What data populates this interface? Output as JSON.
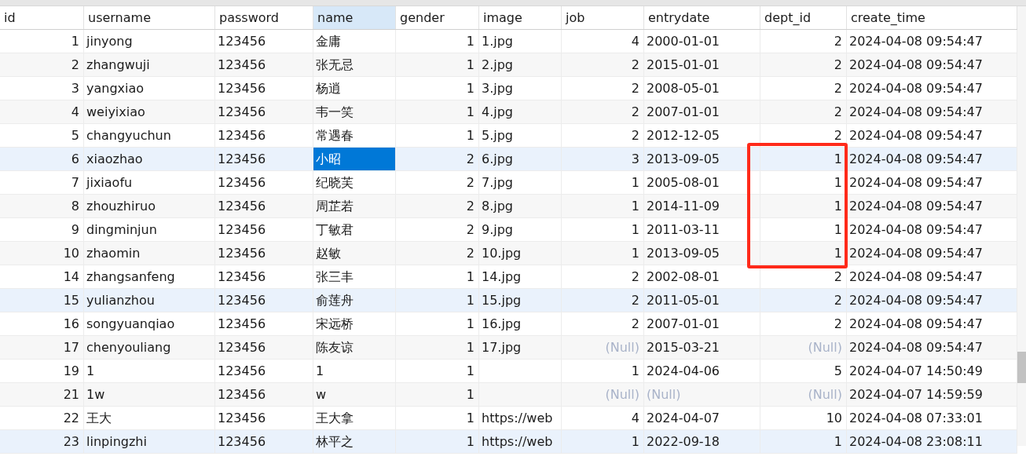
{
  "columns": [
    {
      "label": "id",
      "selected": false
    },
    {
      "label": "username",
      "selected": false
    },
    {
      "label": "password",
      "selected": false
    },
    {
      "label": "name",
      "selected": true
    },
    {
      "label": "gender",
      "selected": false
    },
    {
      "label": "image",
      "selected": false
    },
    {
      "label": "job",
      "selected": false
    },
    {
      "label": "entrydate",
      "selected": false
    },
    {
      "label": "dept_id",
      "selected": false
    },
    {
      "label": "create_time",
      "selected": false
    }
  ],
  "rows": [
    {
      "selected": false,
      "cell_selected": false,
      "boxed": false,
      "cells": [
        "1",
        "jinyong",
        "123456",
        "金庸",
        "1",
        "1.jpg",
        "4",
        "2000-01-01",
        "2",
        "2024-04-08 09:54:47"
      ]
    },
    {
      "selected": false,
      "cell_selected": false,
      "boxed": false,
      "cells": [
        "2",
        "zhangwuji",
        "123456",
        "张无忌",
        "1",
        "2.jpg",
        "2",
        "2015-01-01",
        "2",
        "2024-04-08 09:54:47"
      ]
    },
    {
      "selected": false,
      "cell_selected": false,
      "boxed": false,
      "cells": [
        "3",
        "yangxiao",
        "123456",
        "杨逍",
        "1",
        "3.jpg",
        "2",
        "2008-05-01",
        "2",
        "2024-04-08 09:54:47"
      ]
    },
    {
      "selected": false,
      "cell_selected": false,
      "boxed": false,
      "cells": [
        "4",
        "weiyixiao",
        "123456",
        "韦一笑",
        "1",
        "4.jpg",
        "2",
        "2007-01-01",
        "2",
        "2024-04-08 09:54:47"
      ]
    },
    {
      "selected": false,
      "cell_selected": false,
      "boxed": false,
      "cells": [
        "5",
        "changyuchun",
        "123456",
        "常遇春",
        "1",
        "5.jpg",
        "2",
        "2012-12-05",
        "2",
        "2024-04-08 09:54:47"
      ]
    },
    {
      "selected": true,
      "cell_selected": true,
      "boxed": true,
      "cells": [
        "6",
        "xiaozhao",
        "123456",
        "小昭",
        "2",
        "6.jpg",
        "3",
        "2013-09-05",
        "1",
        "2024-04-08 09:54:47"
      ]
    },
    {
      "selected": false,
      "cell_selected": false,
      "boxed": true,
      "cells": [
        "7",
        "jixiaofu",
        "123456",
        "纪晓芙",
        "2",
        "7.jpg",
        "1",
        "2005-08-01",
        "1",
        "2024-04-08 09:54:47"
      ]
    },
    {
      "selected": false,
      "cell_selected": false,
      "boxed": true,
      "cells": [
        "8",
        "zhouzhiruo",
        "123456",
        "周芷若",
        "2",
        "8.jpg",
        "1",
        "2014-11-09",
        "1",
        "2024-04-08 09:54:47"
      ]
    },
    {
      "selected": false,
      "cell_selected": false,
      "boxed": true,
      "cells": [
        "9",
        "dingminjun",
        "123456",
        "丁敏君",
        "2",
        "9.jpg",
        "1",
        "2011-03-11",
        "1",
        "2024-04-08 09:54:47"
      ]
    },
    {
      "selected": false,
      "cell_selected": false,
      "boxed": true,
      "cells": [
        "10",
        "zhaomin",
        "123456",
        "赵敏",
        "2",
        "10.jpg",
        "1",
        "2013-09-05",
        "1",
        "2024-04-08 09:54:47"
      ]
    },
    {
      "selected": false,
      "cell_selected": false,
      "boxed": false,
      "cells": [
        "14",
        "zhangsanfeng",
        "123456",
        "张三丰",
        "1",
        "14.jpg",
        "2",
        "2002-08-01",
        "2",
        "2024-04-08 09:54:47"
      ]
    },
    {
      "selected": true,
      "cell_selected": false,
      "boxed": false,
      "cells": [
        "15",
        "yulianzhou",
        "123456",
        "俞莲舟",
        "1",
        "15.jpg",
        "2",
        "2011-05-01",
        "2",
        "2024-04-08 09:54:47"
      ]
    },
    {
      "selected": false,
      "cell_selected": false,
      "boxed": false,
      "cells": [
        "16",
        "songyuanqiao",
        "123456",
        "宋远桥",
        "1",
        "16.jpg",
        "2",
        "2007-01-01",
        "2",
        "2024-04-08 09:54:47"
      ]
    },
    {
      "selected": false,
      "cell_selected": false,
      "boxed": false,
      "cells": [
        "17",
        "chenyouliang",
        "123456",
        "陈友谅",
        "1",
        "17.jpg",
        {
          "text": "(Null)",
          "null": true
        },
        "2015-03-21",
        {
          "text": "(Null)",
          "null": true
        },
        "2024-04-08 09:54:47"
      ]
    },
    {
      "selected": false,
      "cell_selected": false,
      "boxed": false,
      "cells": [
        "19",
        "1",
        "123456",
        "1",
        "1",
        "",
        "1",
        "2024-04-06",
        "5",
        "2024-04-07 14:50:49"
      ]
    },
    {
      "selected": false,
      "cell_selected": false,
      "boxed": false,
      "cells": [
        "21",
        "1w",
        "123456",
        "w",
        "1",
        "",
        {
          "text": "(Null)",
          "null": true
        },
        {
          "text": "(Null)",
          "null": true
        },
        {
          "text": "(Null)",
          "null": true
        },
        "2024-04-07 14:59:59"
      ]
    },
    {
      "selected": false,
      "cell_selected": false,
      "boxed": false,
      "cells": [
        "22",
        "王大",
        "123456",
        "王大拿",
        "1",
        "https://web",
        "4",
        "2024-04-07",
        "10",
        "2024-04-08 07:33:01"
      ]
    },
    {
      "selected": true,
      "cell_selected": false,
      "boxed": false,
      "cells": [
        "23",
        "linpingzhi",
        "123456",
        "林平之",
        "1",
        "https://web",
        "1",
        "2022-09-18",
        "1",
        "2024-04-08 23:08:11"
      ]
    }
  ]
}
